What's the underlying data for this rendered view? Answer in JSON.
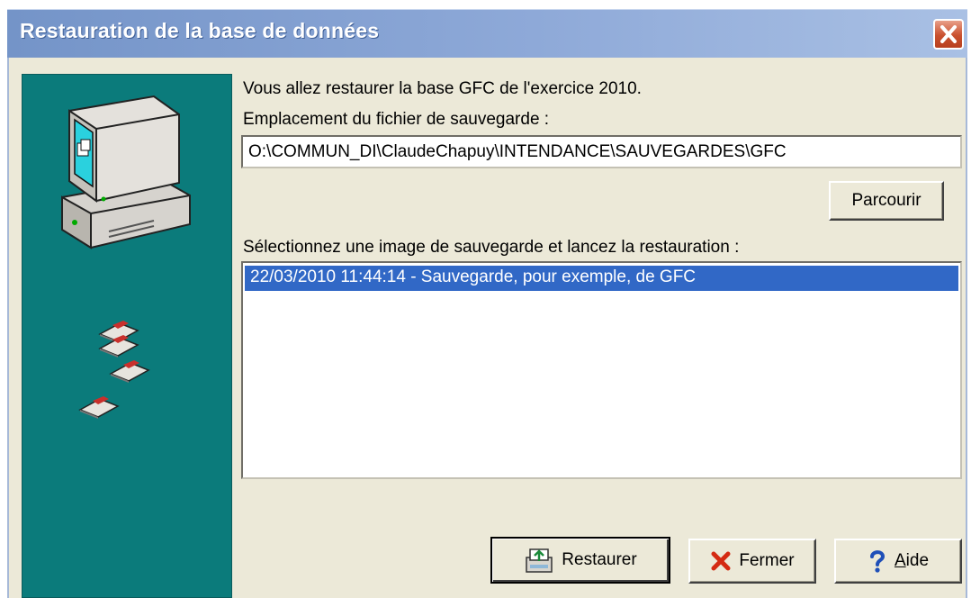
{
  "window": {
    "title": "Restauration de la base de données"
  },
  "message": "Vous allez restaurer la base GFC de l'exercice 2010.",
  "location_label": "Emplacement du fichier de sauvegarde :",
  "location_value": "O:\\COMMUN_DI\\ClaudeChapuy\\INTENDANCE\\SAUVEGARDES\\GFC",
  "browse_label": "Parcourir",
  "select_label": "Sélectionnez une image de sauvegarde et lancez la restauration :",
  "backups": [
    {
      "text": "22/03/2010 11:44:14 - Sauvegarde, pour exemple, de GFC",
      "selected": true
    }
  ],
  "buttons": {
    "restore": "Restaurer",
    "close": "Fermer",
    "help_prefix": "",
    "help_mnemonic": "A",
    "help_rest": "ide"
  },
  "icons": {
    "close": "close-x-icon",
    "computer": "computer-icon",
    "floppy": "floppy-disk-icon",
    "restore": "restore-icon",
    "fermer": "red-x-icon",
    "help": "question-mark-icon"
  },
  "colors": {
    "side_panel": "#0b7b7b",
    "selection": "#3168c6",
    "titlebar": "#7494c8"
  }
}
